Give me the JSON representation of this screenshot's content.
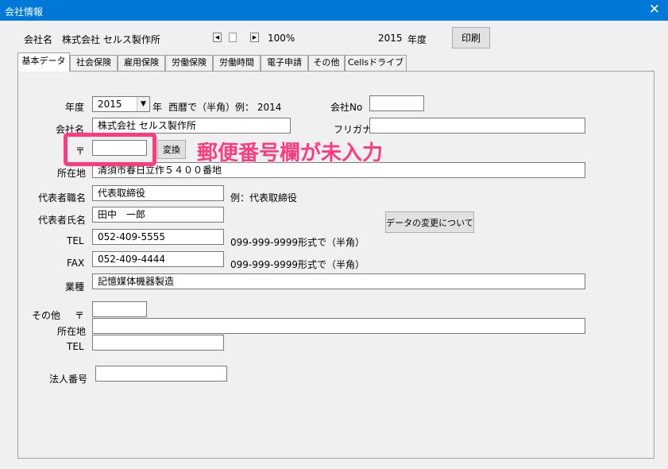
{
  "window": {
    "title": "会社情報",
    "close_glyph": "✕"
  },
  "header": {
    "company_label": "会社名",
    "company_name": "株式会社 セルス製作所",
    "zoom": "100%",
    "year": "2015",
    "year_label": "年度",
    "print_button": "印刷"
  },
  "tabs": [
    {
      "label": "基本データ",
      "active": true
    },
    {
      "label": "社会保険"
    },
    {
      "label": "雇用保険"
    },
    {
      "label": "労働保険"
    },
    {
      "label": "労働時間"
    },
    {
      "label": "電子申請"
    },
    {
      "label": "その他"
    },
    {
      "label": "Cellsドライブ"
    }
  ],
  "form": {
    "fiscal_year_label": "年度",
    "fiscal_year_value": "2015",
    "year_suffix": "年",
    "year_hint": "西暦で（半角）例： 2014",
    "company_no_label": "会社No",
    "company_no_value": "",
    "company_name_label": "会社名",
    "company_name_value": "株式会社 セルス製作所",
    "furigana_label": "フリガナ",
    "furigana_value": "",
    "postal_label": "〒",
    "postal_value": "",
    "convert_button": "変換",
    "address_label": "所在地",
    "address_value": "清須市春日立作５４００番地",
    "rep_title_label": "代表者職名",
    "rep_title_value": "代表取締役",
    "rep_title_hint": "例：代表取締役",
    "rep_name_label": "代表者氏名",
    "rep_name_value": "田中　一郎",
    "data_change_button": "データの変更について",
    "tel_label": "TEL",
    "tel_value": "052-409-5555",
    "tel_hint": "099-999-9999形式で（半角）",
    "fax_label": "FAX",
    "fax_value": "052-409-4444",
    "fax_hint": "099-999-9999形式で（半角）",
    "industry_label": "業種",
    "industry_value": "記憶媒体機器製造",
    "other_label": "その他",
    "other_postal_label": "〒",
    "other_postal_value": "",
    "other_address_label": "所在地",
    "other_address_value": "",
    "other_tel_label": "TEL",
    "other_tel_value": "",
    "corp_number_label": "法人番号",
    "corp_number_value": ""
  },
  "annotation": {
    "text": "郵便番号欄が未入力",
    "color": "#ff3a7f"
  },
  "colors": {
    "titlebar": "#0078d7",
    "panel": "#f0f0f0"
  }
}
